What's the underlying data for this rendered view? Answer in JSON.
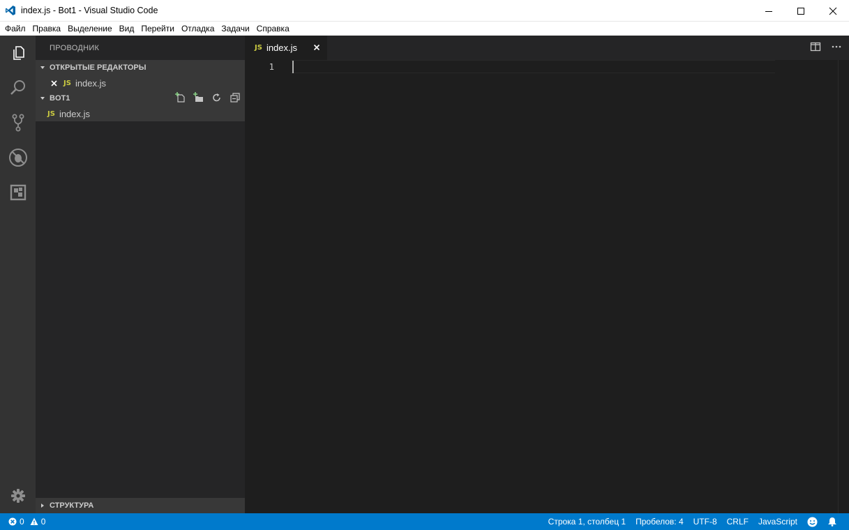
{
  "window": {
    "title": "index.js - Bot1 - Visual Studio Code",
    "controls": {
      "minimize": "minimize-icon",
      "maximize": "maximize-icon",
      "close": "close-icon"
    }
  },
  "menu": {
    "items": [
      "Файл",
      "Правка",
      "Выделение",
      "Вид",
      "Перейти",
      "Отладка",
      "Задачи",
      "Справка"
    ]
  },
  "activity_bar": {
    "icons": [
      "explorer-icon",
      "search-icon",
      "source-control-icon",
      "debug-icon",
      "extensions-icon"
    ],
    "bottom_icon": "gear-icon"
  },
  "sidebar": {
    "title": "ПРОВОДНИК",
    "open_editors": {
      "header": "ОТКРЫТЫЕ РЕДАКТОРЫ",
      "items": [
        {
          "badge": "JS",
          "name": "index.js"
        }
      ]
    },
    "folder": {
      "header": "BOT1",
      "items": [
        {
          "badge": "JS",
          "name": "index.js"
        }
      ],
      "actions": [
        "new-file-icon",
        "new-folder-icon",
        "refresh-icon",
        "collapse-all-icon"
      ]
    },
    "outline": {
      "header": "СТРУКТУРА"
    }
  },
  "editor": {
    "tab": {
      "badge": "JS",
      "label": "index.js"
    },
    "line_numbers": [
      "1"
    ],
    "actions": [
      "split-editor-icon",
      "more-actions-icon"
    ]
  },
  "statusbar": {
    "errors": "0",
    "warnings": "0",
    "position": "Строка 1, столбец 1",
    "spaces": "Пробелов: 4",
    "encoding": "UTF-8",
    "eol": "CRLF",
    "language": "JavaScript",
    "feedback_icon": "smiley-icon",
    "notification_icon": "bell-icon",
    "color": "#007acc"
  },
  "colors": {
    "activity_bar": "#333333",
    "sidebar": "#252526",
    "editor": "#1e1e1e",
    "js_badge": "#cbcb41"
  }
}
